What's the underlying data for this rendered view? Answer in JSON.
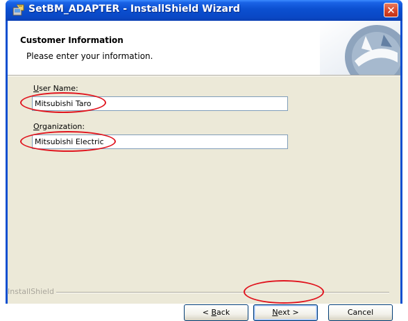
{
  "window": {
    "title": "SetBM_ADAPTER - InstallShield Wizard",
    "close_glyph": "✕"
  },
  "banner": {
    "title": "Customer Information",
    "subtitle": "Please enter your information."
  },
  "form": {
    "user_name_label_mnemonic": "U",
    "user_name_label_rest": "ser Name:",
    "user_name_value": "Mitsubishi Taro",
    "organization_label_mnemonic": "O",
    "organization_label_rest": "rganization:",
    "organization_value": "Mitsubishi Electric"
  },
  "footer": {
    "brand": "InstallShield"
  },
  "buttons": {
    "back_prefix": "< ",
    "back_mnemonic": "B",
    "back_rest": "ack",
    "next_mnemonic": "N",
    "next_rest": "ext >",
    "cancel": "Cancel"
  },
  "colors": {
    "titlebar": "#0b4fd0",
    "dialog_bg": "#ece9d8",
    "highlight": "#e0141e"
  },
  "icons": [
    "installer-icon",
    "close-icon",
    "installshield-logo-icon"
  ]
}
